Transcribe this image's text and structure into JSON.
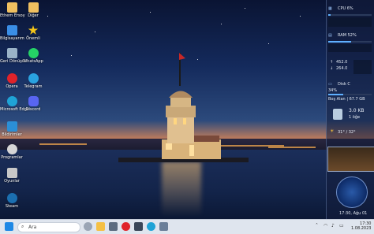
{
  "desktop_icons": [
    {
      "label": "Ethem Ersoy",
      "color": "#f0c060"
    },
    {
      "label": "Diğer",
      "color": "#f0c060"
    },
    {
      "label": "Bilgisayarım",
      "color": "#3a8ee6"
    },
    {
      "label": "Önemli",
      "color": "#f5c518"
    },
    {
      "label": "Geri Dönüşü...",
      "color": "#9ab3c8"
    },
    {
      "label": "WhatsApp",
      "color": "#25d366"
    },
    {
      "label": "Opera",
      "color": "#e0232a"
    },
    {
      "label": "Telegram",
      "color": "#2aa3e0"
    },
    {
      "label": "Microsoft Edge",
      "color": "#1fa3d6"
    },
    {
      "label": "Discord",
      "color": "#5865f2"
    },
    {
      "label": "Bildirimler",
      "color": "#2b8fd6"
    },
    {
      "label": "Programlar",
      "color": "#d6d6d6"
    },
    {
      "label": "Oyunlar",
      "color": "#c8c8c8"
    },
    {
      "label": "Steam",
      "color": "#1b6fb0"
    }
  ],
  "gadgets": {
    "cpu": {
      "label": "CPU 6%",
      "percent": 6
    },
    "ram": {
      "label": "RAM 52%",
      "percent": 52
    },
    "net_up": "452.0",
    "net_down": "264.0",
    "disk": {
      "label": "Disk C",
      "percent_text": "34%",
      "detail": "Boş Alan | 67.7 GB",
      "percent": 34
    },
    "recycle": {
      "size": "3.0 KB",
      "items": "1 öğe"
    },
    "weather": {
      "temp": "31° / 32°"
    },
    "clock": {
      "time_text": "17:30, Ağu 01"
    }
  },
  "taskbar": {
    "search_placeholder": "Ara",
    "time": "17:30",
    "date": "1.08.2023"
  },
  "colors": {
    "accent": "#5fb0ff",
    "taskbar_bg": "#dfe5ee"
  }
}
